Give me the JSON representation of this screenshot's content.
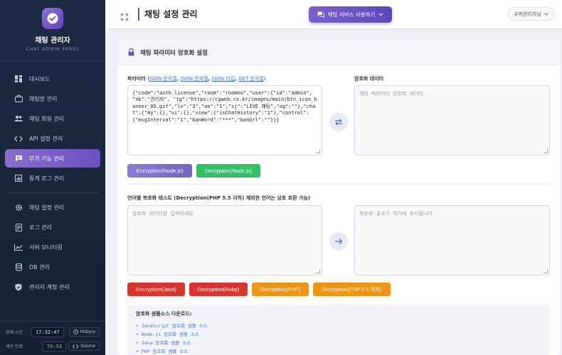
{
  "sidebar": {
    "brand_title": "채팅 관리자",
    "brand_subtitle": "CHAT ADMIN PANEL",
    "items": [
      {
        "label": "대시보드",
        "icon": "dashboard-icon"
      },
      {
        "label": "채팅방 관리",
        "icon": "briefcase-icon"
      },
      {
        "label": "채팅 회원 관리",
        "icon": "users-icon"
      },
      {
        "label": "API 설정 관리",
        "icon": "code-icon"
      },
      {
        "label": "부가 기능 관리",
        "icon": "chat-bubble-icon"
      },
      {
        "label": "통계 로그 관리",
        "icon": "chart-icon"
      },
      {
        "label": "채팅 설정 관리",
        "icon": "gear-icon"
      },
      {
        "label": "로그 관리",
        "icon": "document-icon"
      },
      {
        "label": "서버 모니터링",
        "icon": "line-chart-icon"
      },
      {
        "label": "DB 관리",
        "icon": "database-icon"
      },
      {
        "label": "관리자 계정 관리",
        "icon": "shield-icon"
      }
    ],
    "active_index": 4,
    "current_time_label": "현재 시간",
    "current_time": "17:32:47",
    "history_button": "History",
    "session_label": "세션 만료",
    "session_remaining": "59:58",
    "source_button": "Source"
  },
  "header": {
    "title": "채팅 설정 관리",
    "service_button": "채팅 서비스 사용하기",
    "user_name": "슈퍼관리자님"
  },
  "card": {
    "title": "채팅 파라미터 암호화 설정",
    "param_label": "파라미터",
    "param_links_open": "(",
    "param_links": [
      "JSON 문자열",
      "JSON 문자열",
      "JSON 타입",
      "GET 문자열"
    ],
    "param_links_close": ")",
    "param_value": "{\"code\":\"auth.license\",\"room\":\"roomno\",\"user\":{\"id\":\"admin\", \"nk\":\"관리자\", \"tg\":\"https://cgweb.co.kr/images/main/btn_icon_banner_05.gif\",\"lv\":\"3\",\"an\":\"1\",\"sj\":\"LIVE 채팅\",\"og\":\"\"},\"chat\":{\"my\":{},\"ui\":{},\"view\":{\"isChatHistory\":\"1\"},\"control\":{\"msgInterval\":\"1\",\"banWord\":\"***\",\"banUrl\":\"\"}}}",
    "encrypted_label": "암호화 데이터",
    "encrypted_placeholder": "채팅 파라미터 암호화 데이터",
    "encrypt_node_button": "Encryption(Node.js)",
    "decrypt_node_button": "Decryption(Node.js)",
    "compat_label": "언어별 복호화 테스트 (Decryption(PHP 5.5 이하) 제외한 언어는 상호 호환 가능)",
    "decrypt_input_placeholder": "암호화 데이터를 입력하세요",
    "decrypt_output_placeholder": "복호화 결과가 여기에 표시됩니다",
    "decrypt_buttons": [
      {
        "label": "Decryption(Java)",
        "color": "#d9352c"
      },
      {
        "label": "Decryption(Ruby)",
        "color": "#d9352c"
      },
      {
        "label": "Decryption(PHP)",
        "color": "#ef9414"
      },
      {
        "label": "Decryption(PHP 5.5 이하)",
        "color": "#ef9414"
      }
    ],
    "download_title": "암호화 샘플소스 다운로드:",
    "downloads": [
      "JavaScript 암호화 샘플 소스",
      "Node.js 암호화 샘플 소스",
      "Java 암호화 샘플 소스",
      "PHP 암호화 샘플 소스"
    ]
  },
  "colors": {
    "accent": "#6a51c0",
    "sidebar_bg": "#1e2a44",
    "green": "#2fc162",
    "red": "#d9352c",
    "orange": "#ef9414"
  }
}
